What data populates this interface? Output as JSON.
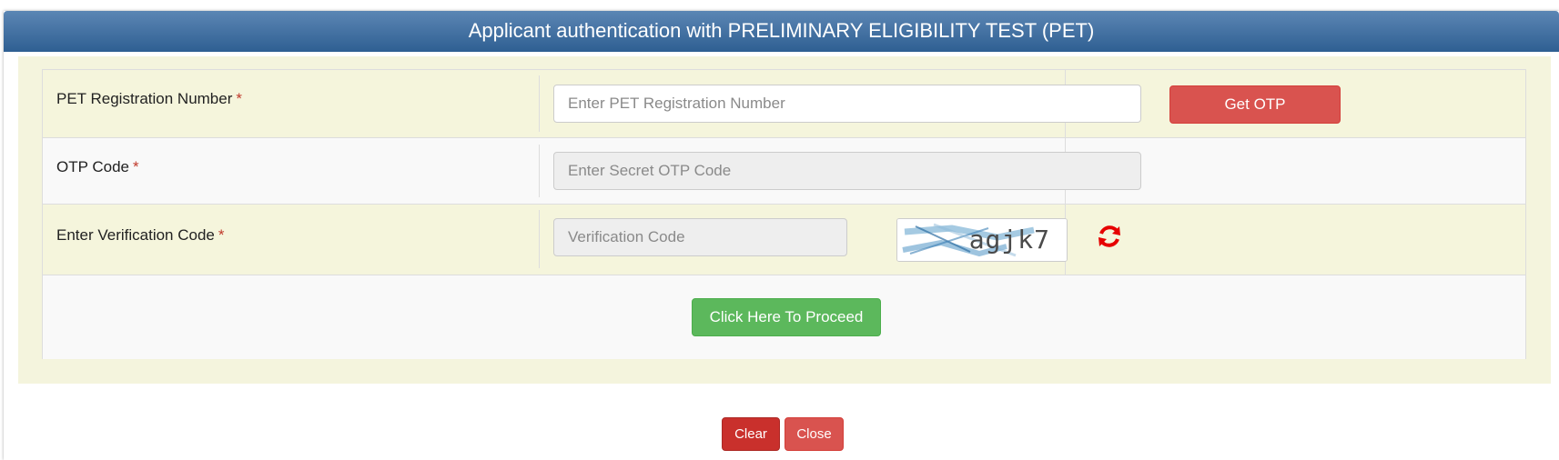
{
  "header": {
    "title": "Applicant authentication with PRELIMINARY ELIGIBILITY TEST (PET)"
  },
  "form": {
    "pet_registration": {
      "label": "PET Registration Number",
      "required_mark": "*",
      "placeholder": "Enter PET Registration Number",
      "value": ""
    },
    "get_otp_label": "Get OTP",
    "otp": {
      "label": "OTP Code",
      "required_mark": "*",
      "placeholder": "Enter Secret OTP Code",
      "value": ""
    },
    "verification": {
      "label": "Enter Verification Code",
      "required_mark": "*",
      "placeholder": "Verification Code",
      "value": "",
      "captcha_text": "agjk7"
    },
    "proceed_label": "Click Here To Proceed"
  },
  "footer": {
    "clear_label": "Clear",
    "close_label": "Close"
  },
  "icons": {
    "refresh": "refresh-icon"
  },
  "colors": {
    "header": "#2f5f92",
    "danger": "#d9534f",
    "success": "#5cb85c",
    "refresh": "#e60000"
  }
}
